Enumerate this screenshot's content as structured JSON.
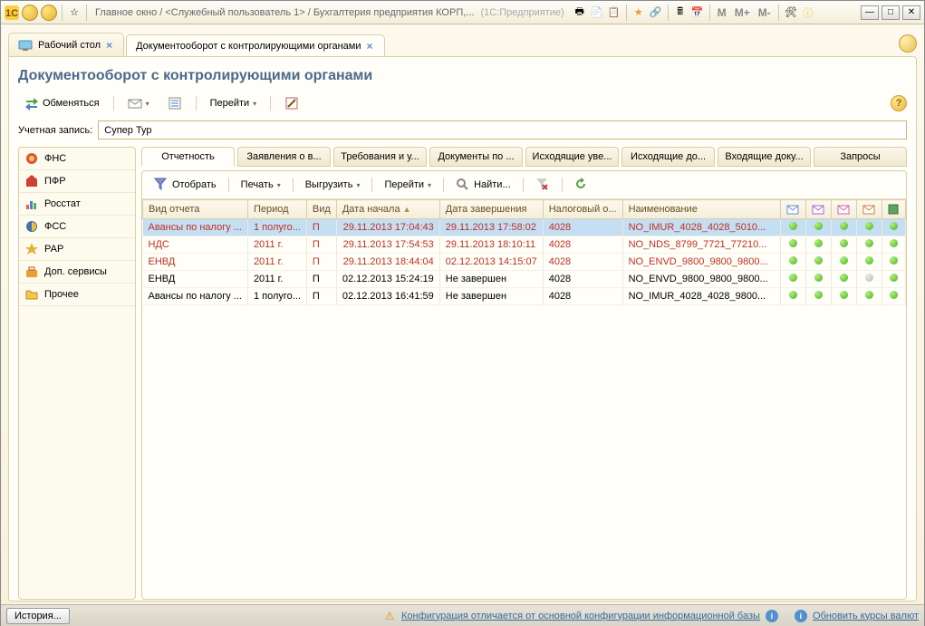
{
  "title": {
    "main": "Главное окно / <Служебный пользователь 1> / Бухгалтерия предприятия КОРП,...",
    "suffix": "(1С:Предприятие)"
  },
  "m_buttons": [
    "M",
    "M+",
    "M-"
  ],
  "worktabs": {
    "desktop": "Рабочий стол",
    "doc": "Документооборот с контролирующими органами"
  },
  "page_title": "Документооборот с контролирующими органами",
  "toolbar1": {
    "exchange": "Обменяться",
    "goto": "Перейти"
  },
  "account": {
    "label": "Учетная запись:",
    "value": "Супер Тур"
  },
  "sidebar": [
    "ФНС",
    "ПФР",
    "Росстат",
    "ФСС",
    "РАР",
    "Доп. сервисы",
    "Прочее"
  ],
  "subtabs": [
    "Отчетность",
    "Заявления о в...",
    "Требования и у...",
    "Документы по ...",
    "Исходящие уве...",
    "Исходящие до...",
    "Входящие доку...",
    "Запросы"
  ],
  "toolbar2": {
    "select": "Отобрать",
    "print": "Печать",
    "export": "Выгрузить",
    "goto": "Перейти",
    "find": "Найти..."
  },
  "columns": [
    "Вид отчета",
    "Период",
    "Вид",
    "Дата начала",
    "Дата завершения",
    "Налоговый о...",
    "Наименование"
  ],
  "rows": [
    {
      "sel": true,
      "red": true,
      "c": [
        "Авансы по налогу ...",
        "1 полуго...",
        "П",
        "29.11.2013 17:04:43",
        "29.11.2013 17:58:02",
        "4028",
        "NO_IMUR_4028_4028_5010..."
      ],
      "d": [
        1,
        1,
        1,
        1,
        1
      ]
    },
    {
      "red": true,
      "c": [
        "НДС",
        "2011 г.",
        "П",
        "29.11.2013 17:54:53",
        "29.11.2013 18:10:11",
        "4028",
        "NO_NDS_8799_7721_77210..."
      ],
      "d": [
        1,
        1,
        1,
        1,
        1
      ]
    },
    {
      "red": true,
      "c": [
        "ЕНВД",
        "2011 г.",
        "П",
        "29.11.2013 18:44:04",
        "02.12.2013 14:15:07",
        "4028",
        "NO_ENVD_9800_9800_9800..."
      ],
      "d": [
        1,
        1,
        1,
        1,
        1
      ]
    },
    {
      "c": [
        "ЕНВД",
        "2011 г.",
        "П",
        "02.12.2013 15:24:19",
        "Не завершен",
        "4028",
        "NO_ENVD_9800_9800_9800..."
      ],
      "d": [
        1,
        1,
        1,
        0,
        1
      ]
    },
    {
      "c": [
        "Авансы по налогу ...",
        "1 полуго...",
        "П",
        "02.12.2013 16:41:59",
        "Не завершен",
        "4028",
        "NO_IMUR_4028_4028_9800..."
      ],
      "d": [
        1,
        1,
        1,
        1,
        1
      ]
    }
  ],
  "footer": {
    "history": "История...",
    "warn": "Конфигурация отличается от основной конфигурации информационной базы",
    "rates": "Обновить курсы валют"
  }
}
